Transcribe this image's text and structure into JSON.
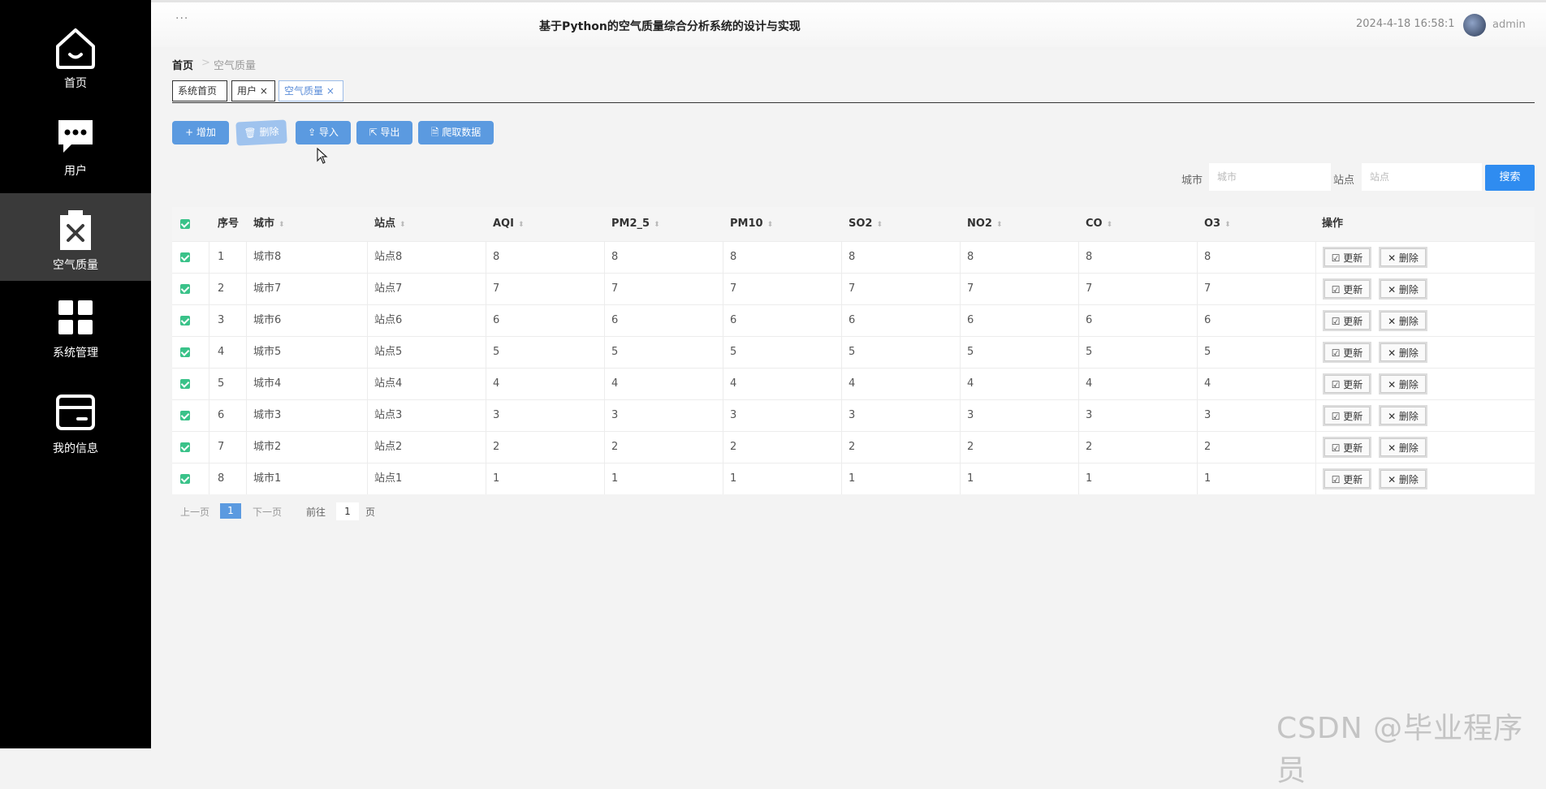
{
  "sidebar": {
    "items": [
      {
        "label": "首页",
        "icon": "home-icon"
      },
      {
        "label": "用户",
        "icon": "chat-icon"
      },
      {
        "label": "空气质量",
        "icon": "clipboard-x-icon",
        "active": true
      },
      {
        "label": "系统管理",
        "icon": "grid-icon"
      },
      {
        "label": "我的信息",
        "icon": "card-icon"
      }
    ]
  },
  "header": {
    "menu": "···",
    "title": "基于Python的空气质量综合分析系统的设计与实现",
    "datetime": "2024-4-18 16:58:1",
    "username": "admin"
  },
  "breadcrumb": {
    "home": "首页",
    "current": "空气质量"
  },
  "tabs": [
    {
      "label": "系统首页"
    },
    {
      "label": "用户 ×"
    },
    {
      "label": "空气质量 ×",
      "active": true
    }
  ],
  "toolbar": {
    "add": "+ 增加",
    "delete": "🗑 删除",
    "import": "⇪ 导入",
    "export": "⇱ 导出",
    "crawl": "🗎 爬取数据"
  },
  "filters": {
    "city_label": "城市",
    "city_placeholder": "城市",
    "station_label": "站点",
    "station_placeholder": "站点",
    "search": "搜索"
  },
  "table": {
    "headers": [
      "序号",
      "城市",
      "站点",
      "AQI",
      "PM2_5",
      "PM10",
      "SO2",
      "NO2",
      "CO",
      "O3",
      "操作"
    ],
    "update_label": "☑ 更新",
    "delete_label": "✕ 删除",
    "rows": [
      {
        "no": "1",
        "city": "城市8",
        "station": "站点8",
        "aqi": "8",
        "pm25": "8",
        "pm10": "8",
        "so2": "8",
        "no2": "8",
        "co": "8",
        "o3": "8"
      },
      {
        "no": "2",
        "city": "城市7",
        "station": "站点7",
        "aqi": "7",
        "pm25": "7",
        "pm10": "7",
        "so2": "7",
        "no2": "7",
        "co": "7",
        "o3": "7"
      },
      {
        "no": "3",
        "city": "城市6",
        "station": "站点6",
        "aqi": "6",
        "pm25": "6",
        "pm10": "6",
        "so2": "6",
        "no2": "6",
        "co": "6",
        "o3": "6"
      },
      {
        "no": "4",
        "city": "城市5",
        "station": "站点5",
        "aqi": "5",
        "pm25": "5",
        "pm10": "5",
        "so2": "5",
        "no2": "5",
        "co": "5",
        "o3": "5"
      },
      {
        "no": "5",
        "city": "城市4",
        "station": "站点4",
        "aqi": "4",
        "pm25": "4",
        "pm10": "4",
        "so2": "4",
        "no2": "4",
        "co": "4",
        "o3": "4"
      },
      {
        "no": "6",
        "city": "城市3",
        "station": "站点3",
        "aqi": "3",
        "pm25": "3",
        "pm10": "3",
        "so2": "3",
        "no2": "3",
        "co": "3",
        "o3": "3"
      },
      {
        "no": "7",
        "city": "城市2",
        "station": "站点2",
        "aqi": "2",
        "pm25": "2",
        "pm10": "2",
        "so2": "2",
        "no2": "2",
        "co": "2",
        "o3": "2"
      },
      {
        "no": "8",
        "city": "城市1",
        "station": "站点1",
        "aqi": "1",
        "pm25": "1",
        "pm10": "1",
        "so2": "1",
        "no2": "1",
        "co": "1",
        "o3": "1"
      }
    ]
  },
  "pagination": {
    "prev": "上一页",
    "current": "1",
    "next": "下一页",
    "goto": "前往",
    "goto_value": "1",
    "page_unit": "页"
  },
  "watermark": "CSDN @毕业程序员",
  "colors": {
    "sidebar_bg": "#000000",
    "sidebar_active": "#3a3a3a",
    "primary": "#5b9ae0",
    "search": "#2f8cf0",
    "checkbox": "#3ac289"
  }
}
